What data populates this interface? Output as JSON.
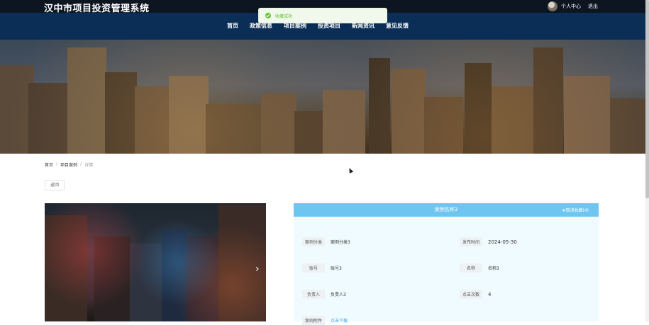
{
  "header": {
    "site_title": "汉中市项目投资管理系统",
    "user_center": "个人中心",
    "logout": "退出"
  },
  "nav": [
    "首页",
    "政策信息",
    "项目案例",
    "投资项目",
    "新闻资讯",
    "意见反馈"
  ],
  "toast": {
    "message": "收藏成功"
  },
  "breadcrumb": [
    "首页",
    "项目案例",
    "详情"
  ],
  "back_label": "返回",
  "detail": {
    "title": "案例名称3",
    "favorite_label": "★取消收藏(4)",
    "fields": [
      {
        "label": "案例分类",
        "value": "案例分类3"
      },
      {
        "label": "发布时间",
        "value": "2024-05-30"
      },
      {
        "label": "账号",
        "value": "账号3"
      },
      {
        "label": "名称",
        "value": "名称3"
      },
      {
        "label": "负责人",
        "value": "负责人3"
      },
      {
        "label": "点击次数",
        "value": "4"
      },
      {
        "label": "案例附件",
        "value": "点击下载"
      }
    ]
  },
  "icons": {
    "gallery_next": "chevron-right-icon",
    "toast": "check-circle-icon"
  },
  "colors": {
    "nav_bg": "#0a2e55",
    "topbar_bg": "#0c1520",
    "detail_header": "#6ec6f0",
    "toast_text": "#67c23a"
  }
}
